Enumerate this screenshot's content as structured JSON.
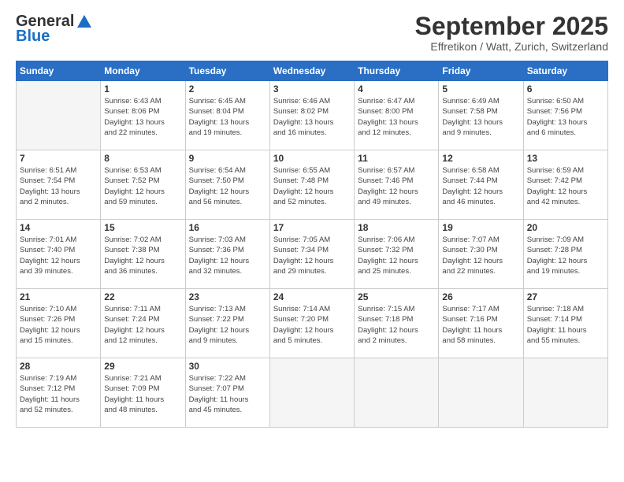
{
  "header": {
    "logo_line1": "General",
    "logo_line2": "Blue",
    "month_title": "September 2025",
    "location": "Effretikon / Watt, Zurich, Switzerland"
  },
  "days_of_week": [
    "Sunday",
    "Monday",
    "Tuesday",
    "Wednesday",
    "Thursday",
    "Friday",
    "Saturday"
  ],
  "weeks": [
    [
      {
        "day": "",
        "sunrise": "",
        "sunset": "",
        "daylight": ""
      },
      {
        "day": "1",
        "sunrise": "Sunrise: 6:43 AM",
        "sunset": "Sunset: 8:06 PM",
        "daylight": "Daylight: 13 hours and 22 minutes."
      },
      {
        "day": "2",
        "sunrise": "Sunrise: 6:45 AM",
        "sunset": "Sunset: 8:04 PM",
        "daylight": "Daylight: 13 hours and 19 minutes."
      },
      {
        "day": "3",
        "sunrise": "Sunrise: 6:46 AM",
        "sunset": "Sunset: 8:02 PM",
        "daylight": "Daylight: 13 hours and 16 minutes."
      },
      {
        "day": "4",
        "sunrise": "Sunrise: 6:47 AM",
        "sunset": "Sunset: 8:00 PM",
        "daylight": "Daylight: 13 hours and 12 minutes."
      },
      {
        "day": "5",
        "sunrise": "Sunrise: 6:49 AM",
        "sunset": "Sunset: 7:58 PM",
        "daylight": "Daylight: 13 hours and 9 minutes."
      },
      {
        "day": "6",
        "sunrise": "Sunrise: 6:50 AM",
        "sunset": "Sunset: 7:56 PM",
        "daylight": "Daylight: 13 hours and 6 minutes."
      }
    ],
    [
      {
        "day": "7",
        "sunrise": "Sunrise: 6:51 AM",
        "sunset": "Sunset: 7:54 PM",
        "daylight": "Daylight: 13 hours and 2 minutes."
      },
      {
        "day": "8",
        "sunrise": "Sunrise: 6:53 AM",
        "sunset": "Sunset: 7:52 PM",
        "daylight": "Daylight: 12 hours and 59 minutes."
      },
      {
        "day": "9",
        "sunrise": "Sunrise: 6:54 AM",
        "sunset": "Sunset: 7:50 PM",
        "daylight": "Daylight: 12 hours and 56 minutes."
      },
      {
        "day": "10",
        "sunrise": "Sunrise: 6:55 AM",
        "sunset": "Sunset: 7:48 PM",
        "daylight": "Daylight: 12 hours and 52 minutes."
      },
      {
        "day": "11",
        "sunrise": "Sunrise: 6:57 AM",
        "sunset": "Sunset: 7:46 PM",
        "daylight": "Daylight: 12 hours and 49 minutes."
      },
      {
        "day": "12",
        "sunrise": "Sunrise: 6:58 AM",
        "sunset": "Sunset: 7:44 PM",
        "daylight": "Daylight: 12 hours and 46 minutes."
      },
      {
        "day": "13",
        "sunrise": "Sunrise: 6:59 AM",
        "sunset": "Sunset: 7:42 PM",
        "daylight": "Daylight: 12 hours and 42 minutes."
      }
    ],
    [
      {
        "day": "14",
        "sunrise": "Sunrise: 7:01 AM",
        "sunset": "Sunset: 7:40 PM",
        "daylight": "Daylight: 12 hours and 39 minutes."
      },
      {
        "day": "15",
        "sunrise": "Sunrise: 7:02 AM",
        "sunset": "Sunset: 7:38 PM",
        "daylight": "Daylight: 12 hours and 36 minutes."
      },
      {
        "day": "16",
        "sunrise": "Sunrise: 7:03 AM",
        "sunset": "Sunset: 7:36 PM",
        "daylight": "Daylight: 12 hours and 32 minutes."
      },
      {
        "day": "17",
        "sunrise": "Sunrise: 7:05 AM",
        "sunset": "Sunset: 7:34 PM",
        "daylight": "Daylight: 12 hours and 29 minutes."
      },
      {
        "day": "18",
        "sunrise": "Sunrise: 7:06 AM",
        "sunset": "Sunset: 7:32 PM",
        "daylight": "Daylight: 12 hours and 25 minutes."
      },
      {
        "day": "19",
        "sunrise": "Sunrise: 7:07 AM",
        "sunset": "Sunset: 7:30 PM",
        "daylight": "Daylight: 12 hours and 22 minutes."
      },
      {
        "day": "20",
        "sunrise": "Sunrise: 7:09 AM",
        "sunset": "Sunset: 7:28 PM",
        "daylight": "Daylight: 12 hours and 19 minutes."
      }
    ],
    [
      {
        "day": "21",
        "sunrise": "Sunrise: 7:10 AM",
        "sunset": "Sunset: 7:26 PM",
        "daylight": "Daylight: 12 hours and 15 minutes."
      },
      {
        "day": "22",
        "sunrise": "Sunrise: 7:11 AM",
        "sunset": "Sunset: 7:24 PM",
        "daylight": "Daylight: 12 hours and 12 minutes."
      },
      {
        "day": "23",
        "sunrise": "Sunrise: 7:13 AM",
        "sunset": "Sunset: 7:22 PM",
        "daylight": "Daylight: 12 hours and 9 minutes."
      },
      {
        "day": "24",
        "sunrise": "Sunrise: 7:14 AM",
        "sunset": "Sunset: 7:20 PM",
        "daylight": "Daylight: 12 hours and 5 minutes."
      },
      {
        "day": "25",
        "sunrise": "Sunrise: 7:15 AM",
        "sunset": "Sunset: 7:18 PM",
        "daylight": "Daylight: 12 hours and 2 minutes."
      },
      {
        "day": "26",
        "sunrise": "Sunrise: 7:17 AM",
        "sunset": "Sunset: 7:16 PM",
        "daylight": "Daylight: 11 hours and 58 minutes."
      },
      {
        "day": "27",
        "sunrise": "Sunrise: 7:18 AM",
        "sunset": "Sunset: 7:14 PM",
        "daylight": "Daylight: 11 hours and 55 minutes."
      }
    ],
    [
      {
        "day": "28",
        "sunrise": "Sunrise: 7:19 AM",
        "sunset": "Sunset: 7:12 PM",
        "daylight": "Daylight: 11 hours and 52 minutes."
      },
      {
        "day": "29",
        "sunrise": "Sunrise: 7:21 AM",
        "sunset": "Sunset: 7:09 PM",
        "daylight": "Daylight: 11 hours and 48 minutes."
      },
      {
        "day": "30",
        "sunrise": "Sunrise: 7:22 AM",
        "sunset": "Sunset: 7:07 PM",
        "daylight": "Daylight: 11 hours and 45 minutes."
      },
      {
        "day": "",
        "sunrise": "",
        "sunset": "",
        "daylight": ""
      },
      {
        "day": "",
        "sunrise": "",
        "sunset": "",
        "daylight": ""
      },
      {
        "day": "",
        "sunrise": "",
        "sunset": "",
        "daylight": ""
      },
      {
        "day": "",
        "sunrise": "",
        "sunset": "",
        "daylight": ""
      }
    ]
  ]
}
